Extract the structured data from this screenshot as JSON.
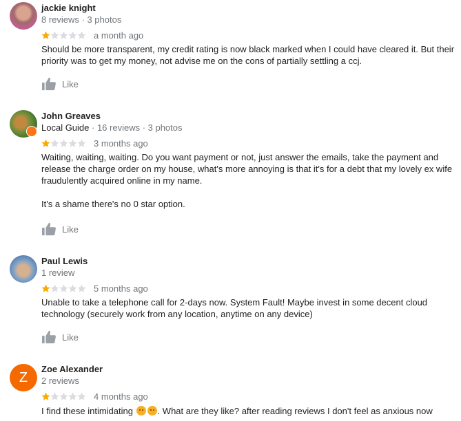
{
  "colors": {
    "star_filled": "#f9ab00",
    "star_empty": "#dadce0",
    "muted": "#70757a",
    "badge": "#f9741a",
    "avatar_z": "#f56a00"
  },
  "reviews": [
    {
      "name": "jackie knight",
      "meta_rest": "8 reviews · 3 photos",
      "rating": 1,
      "date": "a month ago",
      "paragraphs": [
        "Should be more transparent, my credit rating is now black marked when I could have cleared it. But their priority was to get my money, not advise me on the cons of partially settling a ccj."
      ],
      "like": "Like"
    },
    {
      "name": "John Greaves",
      "meta_guide": "Local Guide",
      "meta_rest": " · 16 reviews · 3 photos",
      "rating": 1,
      "date": "3 months ago",
      "paragraphs": [
        "Waiting, waiting, waiting. Do you want payment or not, just answer the emails, take the payment and release the charge order on my house, what's more annoying is that it's for a debt that my lovely ex wife fraudulently acquired online in my name.",
        "It's a shame there's no 0 star option."
      ],
      "like": "Like"
    },
    {
      "name": "Paul Lewis",
      "meta_rest": "1 review",
      "rating": 1,
      "date": "5 months ago",
      "paragraphs": [
        "Unable to take a telephone call for 2-days now. System Fault! Maybe invest in some decent cloud technology (securely work from any location, anytime on any device)"
      ],
      "like": "Like"
    },
    {
      "name": "Zoe Alexander",
      "avatar_letter": "Z",
      "meta_rest": "2 reviews",
      "rating": 1,
      "date": "4 months ago",
      "text_before_emoji": "I find these intimidating ",
      "text_after_emoji": ". What are they like? after reading reviews I don't feel as anxious now"
    }
  ]
}
